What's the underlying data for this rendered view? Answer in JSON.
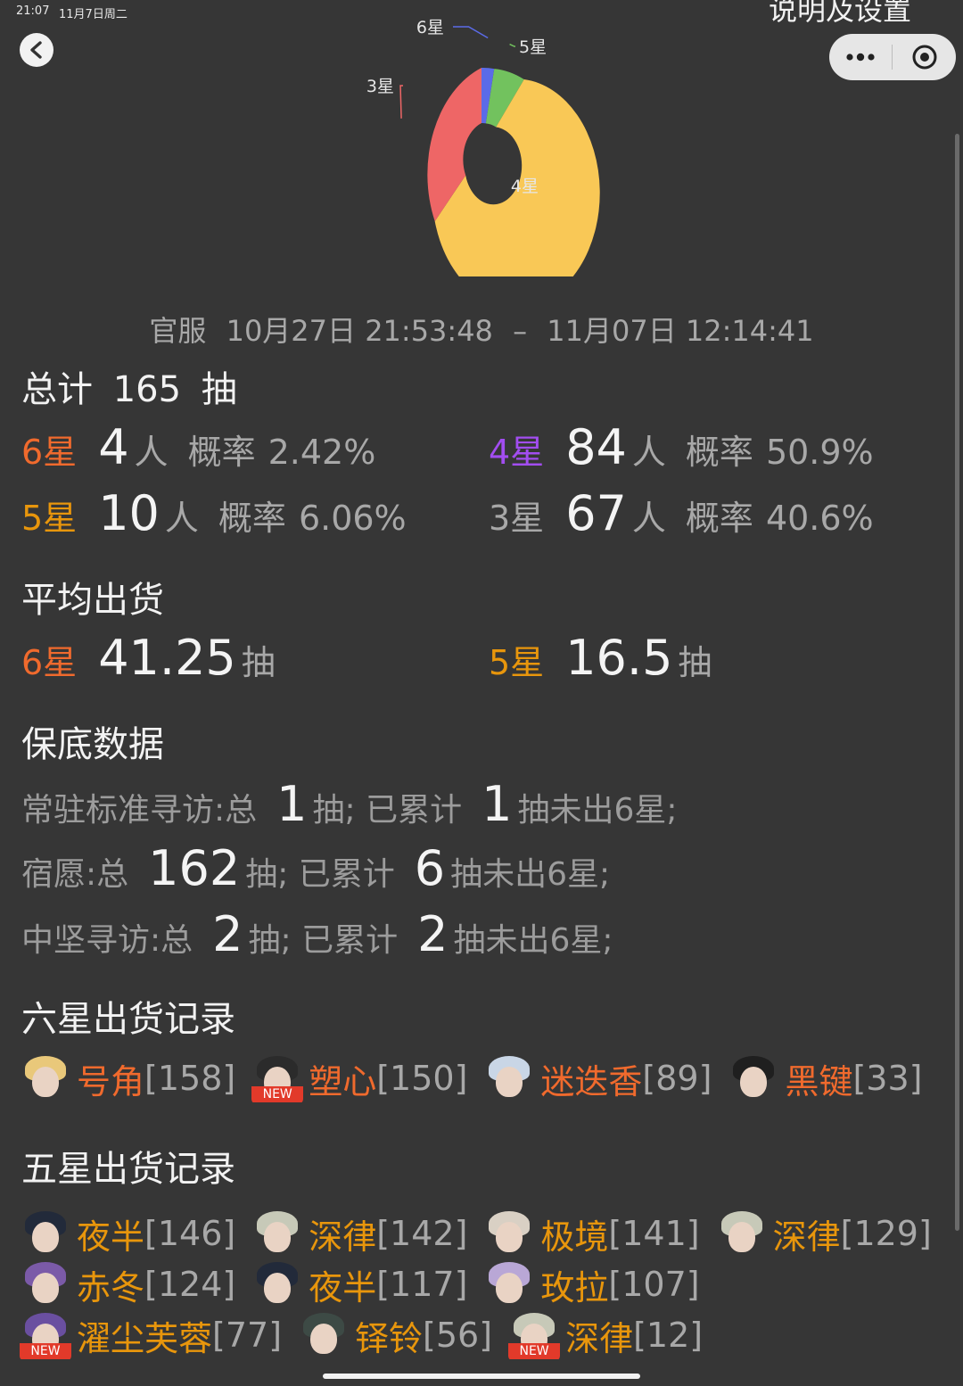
{
  "status_bar": {
    "time": "21:07",
    "date": "11月7日周二"
  },
  "top_title": "说明及设置",
  "icons": {
    "back": "chevron-left-icon",
    "more": "more-dots-icon",
    "close": "record-circle-icon"
  },
  "chart_data": {
    "type": "pie",
    "labels": [
      "6星",
      "5星",
      "4星",
      "3星"
    ],
    "values": [
      4,
      10,
      84,
      67
    ],
    "colors": [
      "#5b6be8",
      "#72c25e",
      "#f9c856",
      "#ee6666"
    ],
    "donut": true
  },
  "summary": {
    "server": "官服",
    "start": "10月27日 21:53:48",
    "dash": "–",
    "end": "11月07日 12:14:41",
    "total_prefix": "总计",
    "total": "165",
    "total_unit": "抽"
  },
  "stats": [
    {
      "star": "6星",
      "count": "4",
      "unit": "人",
      "prob_label": "概率",
      "prob": "2.42%",
      "color": "#f06a2d"
    },
    {
      "star": "4星",
      "count": "84",
      "unit": "人",
      "prob_label": "概率",
      "prob": "50.9%",
      "color": "#a24df0"
    },
    {
      "star": "5星",
      "count": "10",
      "unit": "人",
      "prob_label": "概率",
      "prob": "6.06%",
      "color": "#e8960c"
    },
    {
      "star": "3星",
      "count": "67",
      "unit": "人",
      "prob_label": "概率",
      "prob": "40.6%",
      "color": "#a8a8a8"
    }
  ],
  "average": {
    "title": "平均出货",
    "six": {
      "star": "6星",
      "value": "41.25",
      "unit": "抽"
    },
    "five": {
      "star": "5星",
      "value": "16.5",
      "unit": "抽"
    }
  },
  "pity": {
    "title": "保底数据",
    "rows": [
      {
        "pool": "常驻标准寻访:总",
        "total": "1",
        "mid": "抽;  已累计",
        "acc": "1",
        "tail": "抽未出6星;"
      },
      {
        "pool": "宿愿:总",
        "total": "162",
        "mid": "抽;  已累计",
        "acc": "6",
        "tail": "抽未出6星;"
      },
      {
        "pool": "中坚寻访:总",
        "total": "2",
        "mid": "抽;  已累计",
        "acc": "2",
        "tail": "抽未出6星;"
      }
    ]
  },
  "six_records": {
    "title": "六星出货记录",
    "new_label": "NEW",
    "items": [
      {
        "name": "号角",
        "count": "[158]",
        "new": false,
        "hair": "#e9c87a"
      },
      {
        "name": "塑心",
        "count": "[150]",
        "new": true,
        "hair": "#2b2b2b"
      },
      {
        "name": "迷迭香",
        "count": "[89]",
        "new": false,
        "hair": "#c9d6e6"
      },
      {
        "name": "黑键",
        "count": "[33]",
        "new": false,
        "hair": "#1f1f1f"
      }
    ]
  },
  "five_records": {
    "title": "五星出货记录",
    "new_label": "NEW",
    "rows": [
      [
        {
          "name": "夜半",
          "count": "[146]",
          "new": false,
          "hair": "#222a3a"
        },
        {
          "name": "深律",
          "count": "[142]",
          "new": false,
          "hair": "#c7c9b8"
        },
        {
          "name": "极境",
          "count": "[141]",
          "new": false,
          "hair": "#d9d0c4"
        },
        {
          "name": "深律",
          "count": "[129]",
          "new": false,
          "hair": "#c7c9b8"
        }
      ],
      [
        {
          "name": "赤冬",
          "count": "[124]",
          "new": false,
          "hair": "#7b5aa8"
        },
        {
          "name": "夜半",
          "count": "[117]",
          "new": false,
          "hair": "#222a3a"
        },
        {
          "name": "玫拉",
          "count": "[107]",
          "new": false,
          "hair": "#b9a7d6"
        }
      ],
      [
        {
          "name": "濯尘芙蓉",
          "count": "[77]",
          "new": true,
          "hair": "#6a4fa0"
        },
        {
          "name": "铎铃",
          "count": "[56]",
          "new": false,
          "hair": "#3d4a45"
        },
        {
          "name": "深律",
          "count": "[12]",
          "new": true,
          "hair": "#c7c9b8"
        }
      ]
    ]
  }
}
